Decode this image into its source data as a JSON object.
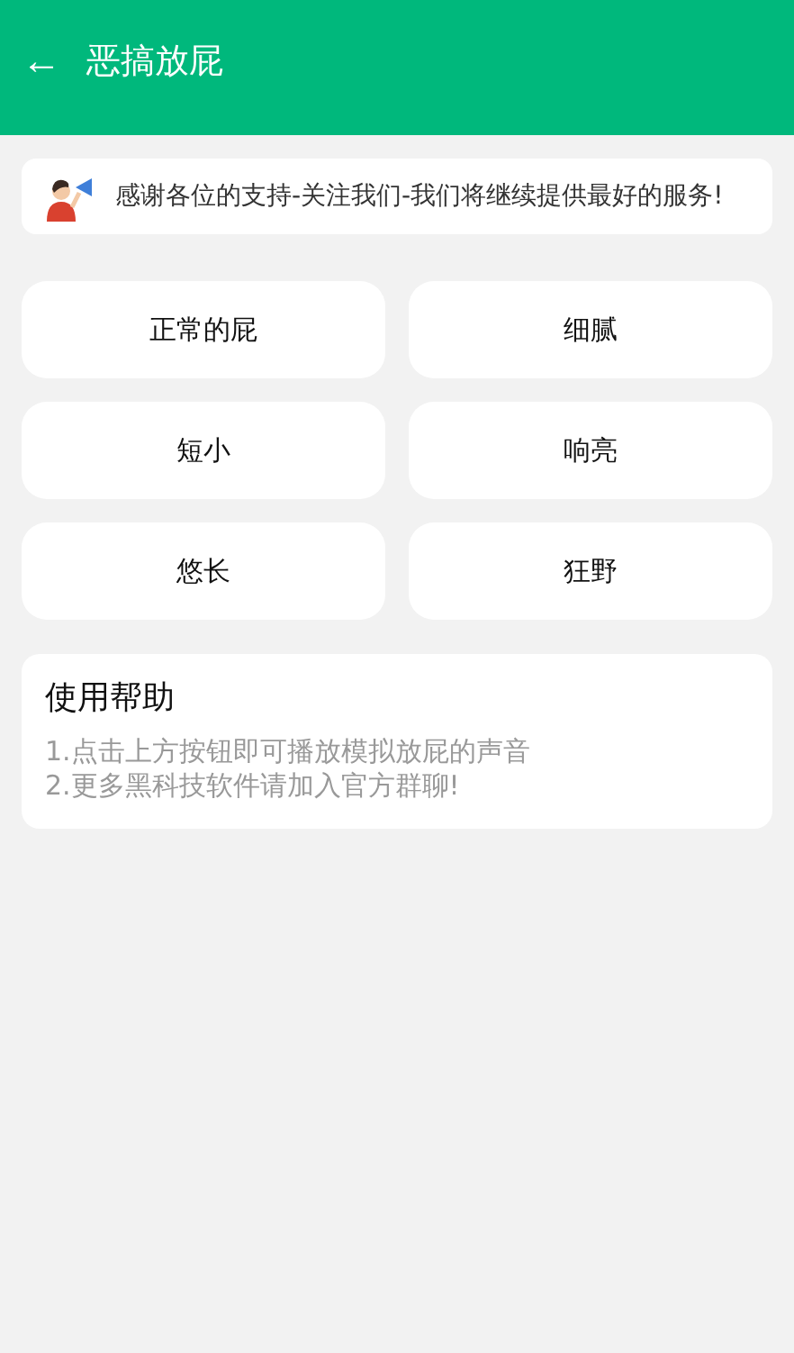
{
  "header": {
    "back": "←",
    "title": "恶搞放屁"
  },
  "notice": {
    "text": "感谢各位的支持-关注我们-我们将继续提供最好的服务!"
  },
  "sounds": [
    "正常的屁",
    "细腻",
    "短小",
    "响亮",
    "悠长",
    "狂野"
  ],
  "help": {
    "title": "使用帮助",
    "lines": [
      "1.点击上方按钮即可播放模拟放屁的声音",
      "2.更多黑科技软件请加入官方群聊!"
    ]
  }
}
